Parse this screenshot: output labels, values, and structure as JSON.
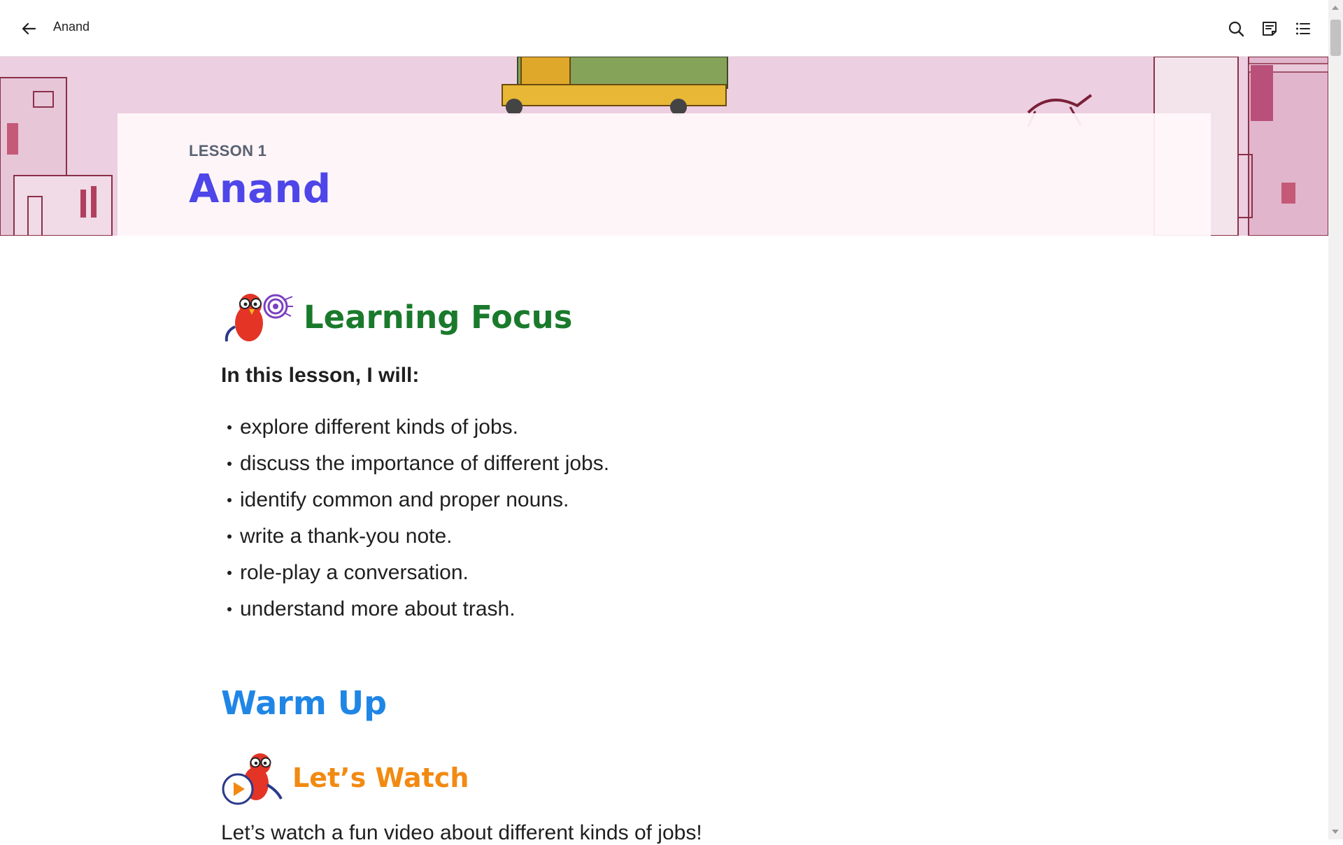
{
  "header": {
    "title": "Anand",
    "icons": [
      "back-arrow-icon",
      "search-icon",
      "notes-icon",
      "table-of-contents-icon"
    ]
  },
  "lesson": {
    "label": "LESSON 1",
    "title": "Anand"
  },
  "learning_focus": {
    "heading": "Learning Focus",
    "intro": "In this lesson, I will:",
    "items": [
      "explore different kinds of jobs.",
      "discuss the importance of different jobs.",
      "identify common and proper nouns.",
      "write a thank-you note.",
      "role-play a conversation.",
      "understand more about trash."
    ]
  },
  "warm_up": {
    "heading": "Warm Up",
    "lets_watch": {
      "heading": "Let’s Watch",
      "text": "Let’s watch a fun video about different kinds of jobs!"
    }
  },
  "colors": {
    "lesson_title": "#4e46e8",
    "learning_focus": "#1a7a2c",
    "warm_up": "#1f86e6",
    "lets_watch": "#f28a12"
  }
}
